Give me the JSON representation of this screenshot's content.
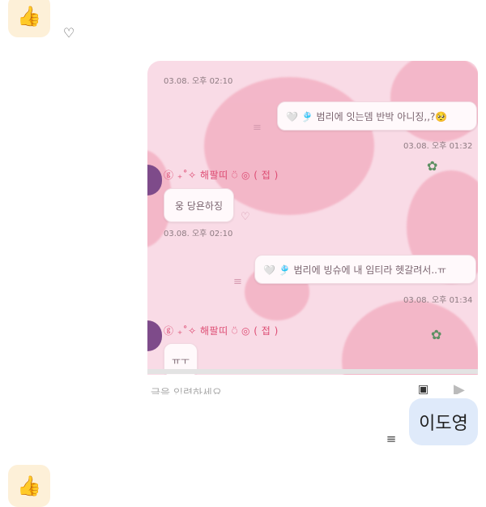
{
  "messages": {
    "top_emoji": "👍",
    "bottom_emoji": "👍",
    "heart_icon": "heart-plus-icon",
    "menu_icon": "reply-menu-icon",
    "main_text": "이도영"
  },
  "screenshot": {
    "inner_messages": [
      {
        "kind": "time",
        "text": "03.08. 오후 02:10"
      },
      {
        "kind": "outgoing",
        "text": "🤍 🎐 범리에 잇는뎀 반박 아니징,,?🥺",
        "time": "03.08. 오후 01:32"
      },
      {
        "kind": "sender",
        "text": "ⓖ ₊˚✧ 해팔띠 ⍥ ◎ ( 접 )"
      },
      {
        "kind": "incoming",
        "text": "웅 당욘하징",
        "time": "03.08. 오후 02:10"
      },
      {
        "kind": "outgoing",
        "text": "🤍 🎐 범리에 빙슈에 내 임티라 헷갈려서..ㅠ",
        "time": "03.08. 오후 01:34"
      },
      {
        "kind": "sender",
        "text": "ⓖ ₊˚✧ 해팔띠 ⍥ ◎ ( 접 )"
      },
      {
        "kind": "incoming",
        "text": "ㅠㅜ"
      }
    ],
    "input_placeholder": "글을 입력하세요"
  }
}
